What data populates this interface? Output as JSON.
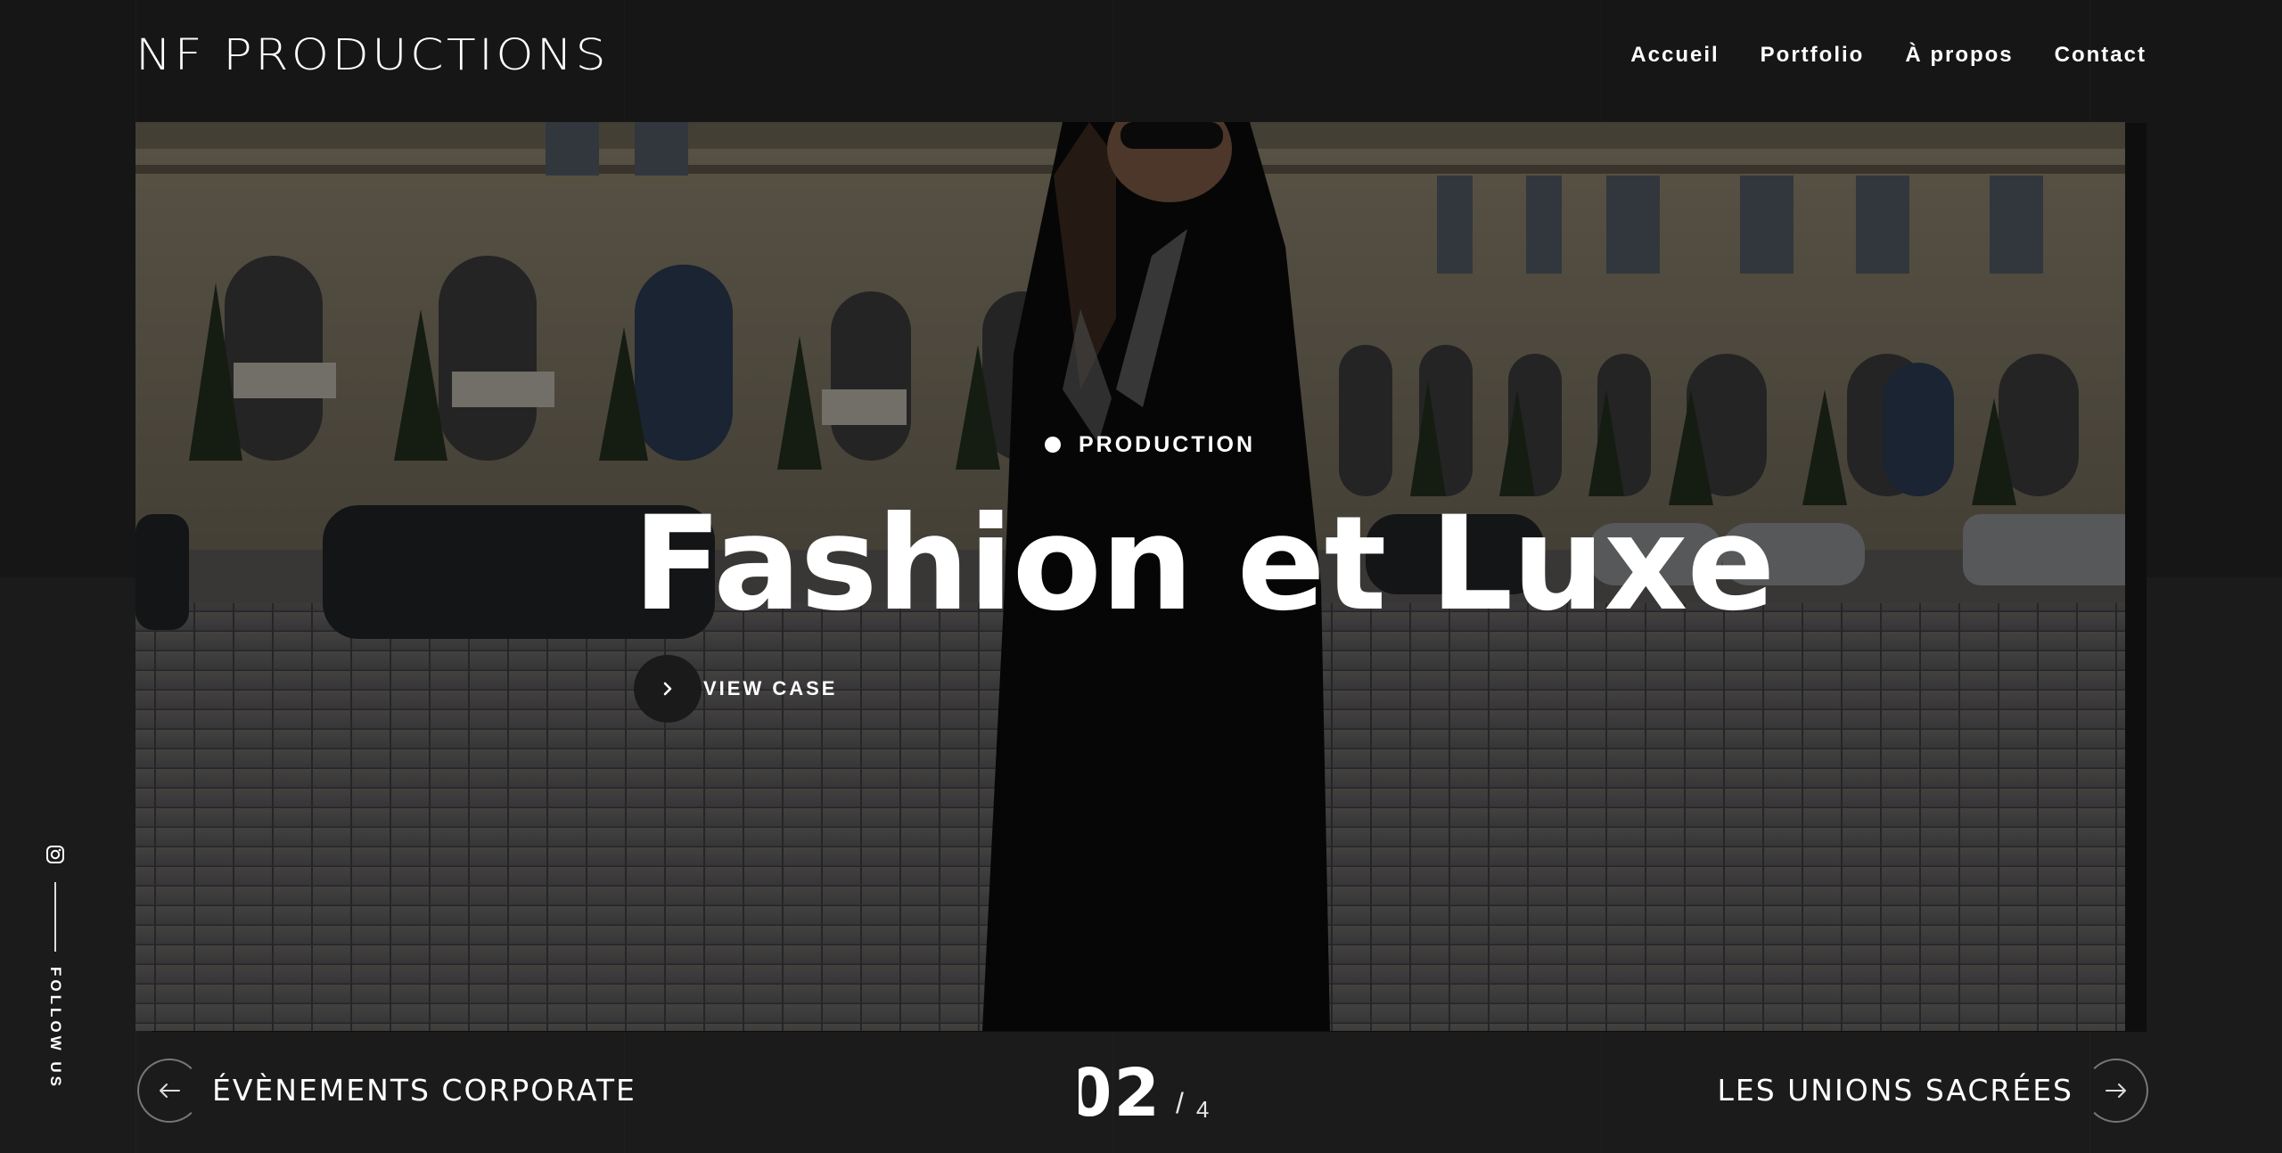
{
  "header": {
    "logo": "NF PRODUCTIONS",
    "nav": [
      {
        "label": "Accueil"
      },
      {
        "label": "Portfolio"
      },
      {
        "label": "À propos"
      },
      {
        "label": "Contact"
      }
    ]
  },
  "hero": {
    "category": "PRODUCTION",
    "title": "Fashion et Luxe",
    "cta_label": "VIEW CASE",
    "image_alt_icon": "photo-fashion-model-place-vendome"
  },
  "social": {
    "label": "FOLLOW US",
    "icon": "instagram-icon"
  },
  "slider": {
    "prev_label": "ÉVÈNEMENTS CORPORATE",
    "next_label": "LES UNIONS SACRÉES",
    "current": "02",
    "separator": "/",
    "total": "4"
  },
  "colors": {
    "background": "#161616",
    "text": "#ffffff",
    "cta_circle": "#1a1a1a"
  }
}
